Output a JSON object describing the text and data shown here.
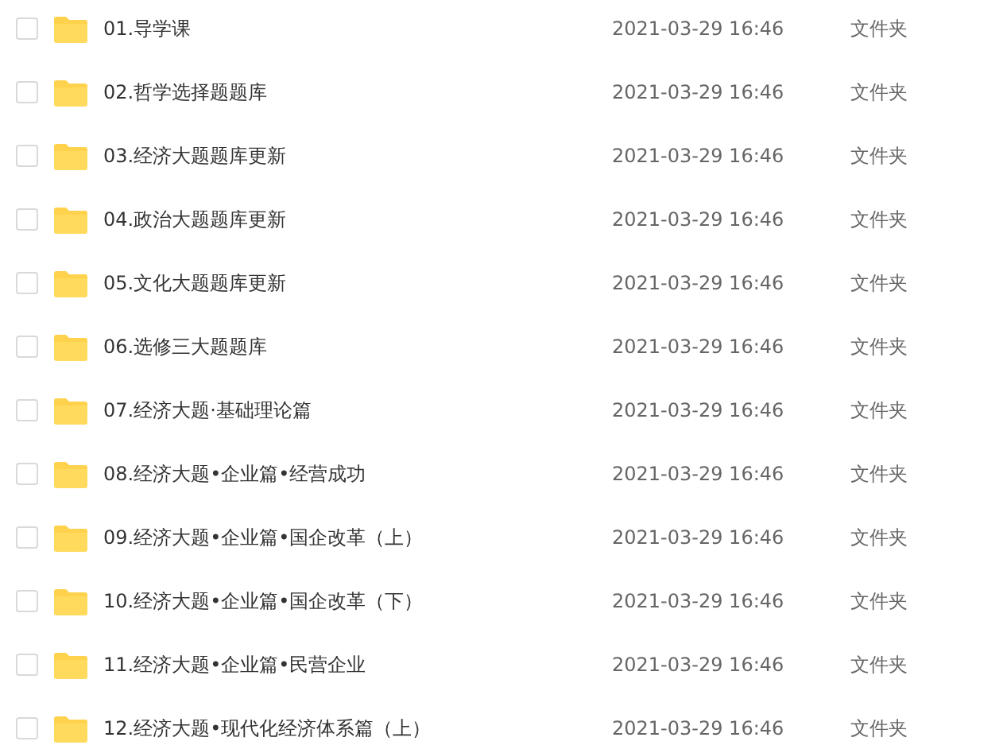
{
  "files": [
    {
      "checked": false,
      "name": "01.导学课",
      "modified": "2021-03-29 16:46",
      "type": "文件夹"
    },
    {
      "checked": false,
      "name": "02.哲学选择题题库",
      "modified": "2021-03-29 16:46",
      "type": "文件夹"
    },
    {
      "checked": false,
      "name": "03.经济大题题库更新",
      "modified": "2021-03-29 16:46",
      "type": "文件夹"
    },
    {
      "checked": false,
      "name": "04.政治大题题库更新",
      "modified": "2021-03-29 16:46",
      "type": "文件夹"
    },
    {
      "checked": false,
      "name": "05.文化大题题库更新",
      "modified": "2021-03-29 16:46",
      "type": "文件夹"
    },
    {
      "checked": false,
      "name": "06.选修三大题题库",
      "modified": "2021-03-29 16:46",
      "type": "文件夹"
    },
    {
      "checked": false,
      "name": "07.经济大题·基础理论篇",
      "modified": "2021-03-29 16:46",
      "type": "文件夹"
    },
    {
      "checked": false,
      "name": "08.经济大题•企业篇•经营成功",
      "modified": "2021-03-29 16:46",
      "type": "文件夹"
    },
    {
      "checked": false,
      "name": "09.经济大题•企业篇•国企改革（上）",
      "modified": "2021-03-29 16:46",
      "type": "文件夹"
    },
    {
      "checked": false,
      "name": "10.经济大题•企业篇•国企改革（下）",
      "modified": "2021-03-29 16:46",
      "type": "文件夹"
    },
    {
      "checked": false,
      "name": "11.经济大题•企业篇•民营企业",
      "modified": "2021-03-29 16:46",
      "type": "文件夹"
    },
    {
      "checked": false,
      "name": "12.经济大题•现代化经济体系篇（上）",
      "modified": "2021-03-29 16:46",
      "type": "文件夹"
    }
  ]
}
